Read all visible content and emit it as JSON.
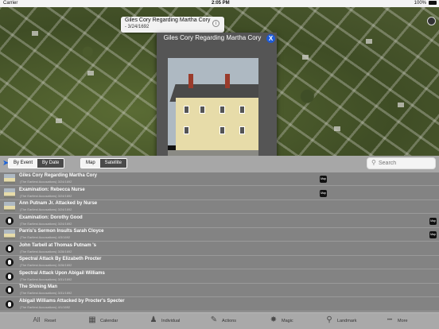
{
  "status_bar": {
    "carrier": "Carrier",
    "time": "2:05 PM",
    "battery": "100%"
  },
  "map_callout": {
    "title": "Giles Cory Regarding Martha Cory",
    "subtitle": "- 3/24/1692"
  },
  "popup": {
    "title": "Giles Cory Regarding Martha Cory",
    "close_label": "X",
    "toggle_on": true
  },
  "controls": {
    "event_tabs": [
      {
        "label": "By Event",
        "selected": true
      },
      {
        "label": "By Date",
        "selected": false
      }
    ],
    "map_tabs": [
      {
        "label": "Map",
        "selected": true
      },
      {
        "label": "Satellite",
        "selected": false
      }
    ],
    "search_placeholder": "Search"
  },
  "events": [
    {
      "title": "Giles Cory Regarding Martha Cory",
      "subtitle": "(The Earliest Accusations) 3/24/1692",
      "thumb": "photo",
      "map_label": "Map",
      "map_pos": "mid"
    },
    {
      "title": "Examination: Rebecca Nurse",
      "subtitle": "(The Earliest Accusations) 3/24/1692",
      "thumb": "photo",
      "map_label": "Map",
      "map_pos": "mid"
    },
    {
      "title": "Ann Putnam Jr. Attacked by Nurse",
      "subtitle": "(The Earliest Accusations) 3/24/1692",
      "thumb": "photo"
    },
    {
      "title": "Examination: Dorothy Good",
      "subtitle": "(The Earliest Accusations) 3/24/1692",
      "thumb": "pin",
      "map_label": "Map",
      "map_pos": "right"
    },
    {
      "title": "Parris's Sermon Insults Sarah Cloyce",
      "subtitle": "(The Earliest Accusations) 4/3/1692",
      "thumb": "photo",
      "map_label": "Map",
      "map_pos": "right"
    },
    {
      "title": "John Tarbell at Thomas Putnam 's",
      "subtitle": "(The Earliest Accusations) 3/28/1692",
      "thumb": "pin"
    },
    {
      "title": "Spectral Attack By Elizabeth Procter",
      "subtitle": "(The Earliest Accusations) 3/28/1692",
      "thumb": "pin"
    },
    {
      "title": "Spectral Attack Upon Abigail Williams",
      "subtitle": "(The Earliest Accusations) 3/31/1692",
      "thumb": "pin"
    },
    {
      "title": "The Shining Man",
      "subtitle": "(The Earliest Accusations) 3/31/1692",
      "thumb": "pin"
    },
    {
      "title": "Abigail Williams Attacked by Procter's Specter",
      "subtitle": "(The Earliest Accusations) 4/1/1692",
      "thumb": "pin"
    }
  ],
  "tabbar": [
    {
      "label": "Reset",
      "icon": "all-icon",
      "glyph": "All"
    },
    {
      "label": "Calendar",
      "icon": "calendar-icon",
      "glyph": "▦"
    },
    {
      "label": "Individual",
      "icon": "person-icon",
      "glyph": "♟"
    },
    {
      "label": "Actions",
      "icon": "actions-icon",
      "glyph": "✎"
    },
    {
      "label": "Magic",
      "icon": "magic-icon",
      "glyph": "✸"
    },
    {
      "label": "Landmark",
      "icon": "landmark-icon",
      "glyph": "⚲"
    },
    {
      "label": "More",
      "icon": "more-icon",
      "glyph": "•••"
    }
  ]
}
